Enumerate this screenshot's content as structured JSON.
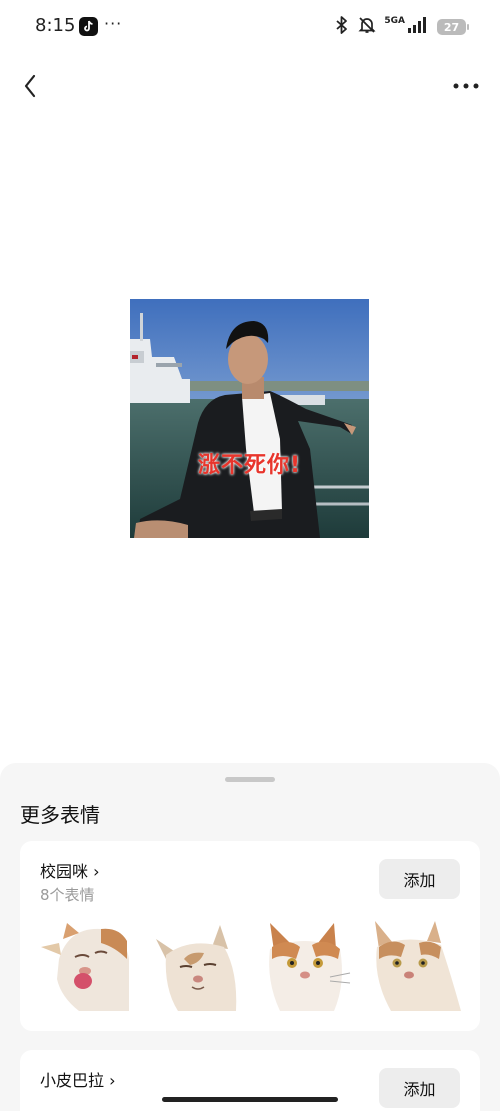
{
  "status_bar": {
    "time": "8:15",
    "dots": "···",
    "network": "5GA",
    "battery": "27",
    "icons": [
      "tiktok-icon",
      "bluetooth-icon",
      "mute-icon",
      "signal-icon",
      "battery-icon"
    ]
  },
  "nav": {
    "icons": [
      "back-icon",
      "more-icon"
    ]
  },
  "sticker": {
    "caption": "涨不死你!"
  },
  "sheet": {
    "title": "更多表情",
    "packs": [
      {
        "name": "校园咪 ›",
        "count": "8个表情",
        "add_label": "添加"
      },
      {
        "name": "小皮巴拉 ›",
        "add_label": "添加"
      }
    ]
  },
  "colors": {
    "caption": "#e8352c",
    "sheet_bg": "#f6f6f6",
    "button_bg": "#ededed",
    "muted_text": "#9a9a9a"
  }
}
